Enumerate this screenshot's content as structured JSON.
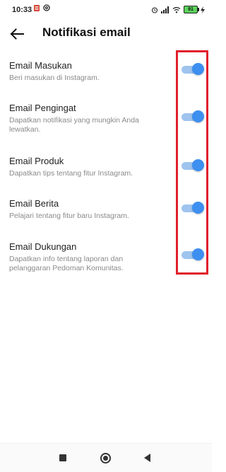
{
  "status_bar": {
    "time": "10:33",
    "battery": "91"
  },
  "header": {
    "title": "Notifikasi email"
  },
  "settings": [
    {
      "title": "Email Masukan",
      "description": "Beri masukan di Instagram.",
      "enabled": true
    },
    {
      "title": "Email Pengingat",
      "description": "Dapatkan notifikasi yang mungkin Anda lewatkan.",
      "enabled": true
    },
    {
      "title": "Email Produk",
      "description": "Dapatkan tips tentang fitur Instagram.",
      "enabled": true
    },
    {
      "title": "Email Berita",
      "description": "Pelajari tentang fitur baru Instagram.",
      "enabled": true
    },
    {
      "title": "Email Dukungan",
      "description": "Dapatkan info tentang laporan dan pelanggaran Pedoman Komunitas.",
      "enabled": true
    }
  ],
  "colors": {
    "toggle_knob": "#3d8ff0",
    "toggle_track": "#9ec4ef",
    "highlight": "#e0202b"
  },
  "icons": {
    "back": "arrow-left-icon",
    "nav_recents": "square-icon",
    "nav_home": "circle-icon",
    "nav_back": "triangle-icon"
  }
}
